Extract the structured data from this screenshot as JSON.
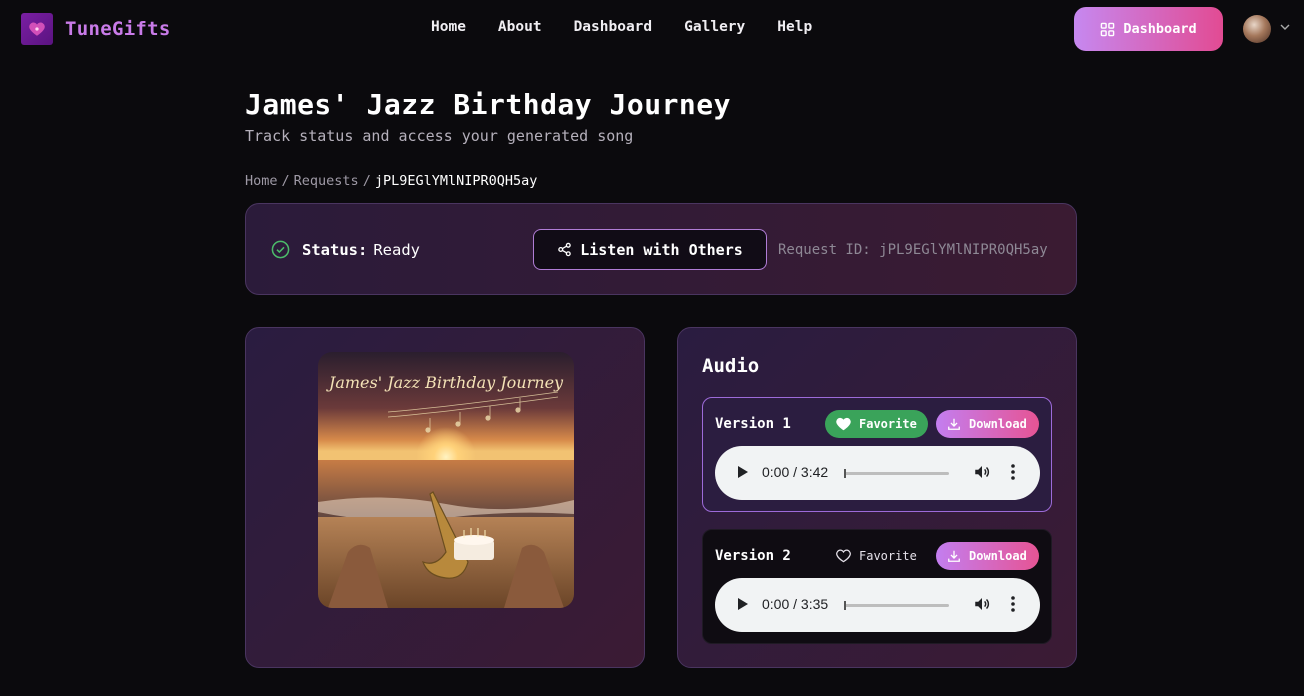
{
  "nav": {
    "brand": "TuneGifts",
    "links": [
      "Home",
      "About",
      "Dashboard",
      "Gallery",
      "Help"
    ],
    "cta_label": "Dashboard"
  },
  "header": {
    "title": "James' Jazz Birthday Journey",
    "subtitle": "Track status and access your generated song"
  },
  "breadcrumb": {
    "items": [
      "Home",
      "Requests"
    ],
    "current": "jPL9EGlYMlNIPR0QH5ay"
  },
  "status": {
    "label": "Status:",
    "value": "Ready",
    "listen_label": "Listen with Others",
    "request_id_text": "Request ID: jPL9EGlYMlNIPR0QH5ay"
  },
  "artwork": {
    "caption": "James' Jazz Birthday Journey"
  },
  "audio": {
    "title": "Audio",
    "versions": [
      {
        "label": "Version 1",
        "favorite_label": "Favorite",
        "favorited": true,
        "download_label": "Download",
        "time": "0:00 / 3:42"
      },
      {
        "label": "Version 2",
        "favorite_label": "Favorite",
        "favorited": false,
        "download_label": "Download",
        "time": "0:00 / 3:35"
      }
    ]
  },
  "colors": {
    "accent_gradient_start": "#c688f0",
    "accent_gradient_end": "#e24b93",
    "brand": "#c97be8",
    "favorite_green": "#3aa35a",
    "status_green": "#4cbb6a"
  },
  "icons": {
    "logo": "heart-logo-icon",
    "cta": "grid-icon",
    "status": "check-circle-icon",
    "listen": "share-icon",
    "favorite_on": "heart-filled-icon",
    "favorite_off": "heart-outline-icon",
    "download": "download-icon"
  }
}
